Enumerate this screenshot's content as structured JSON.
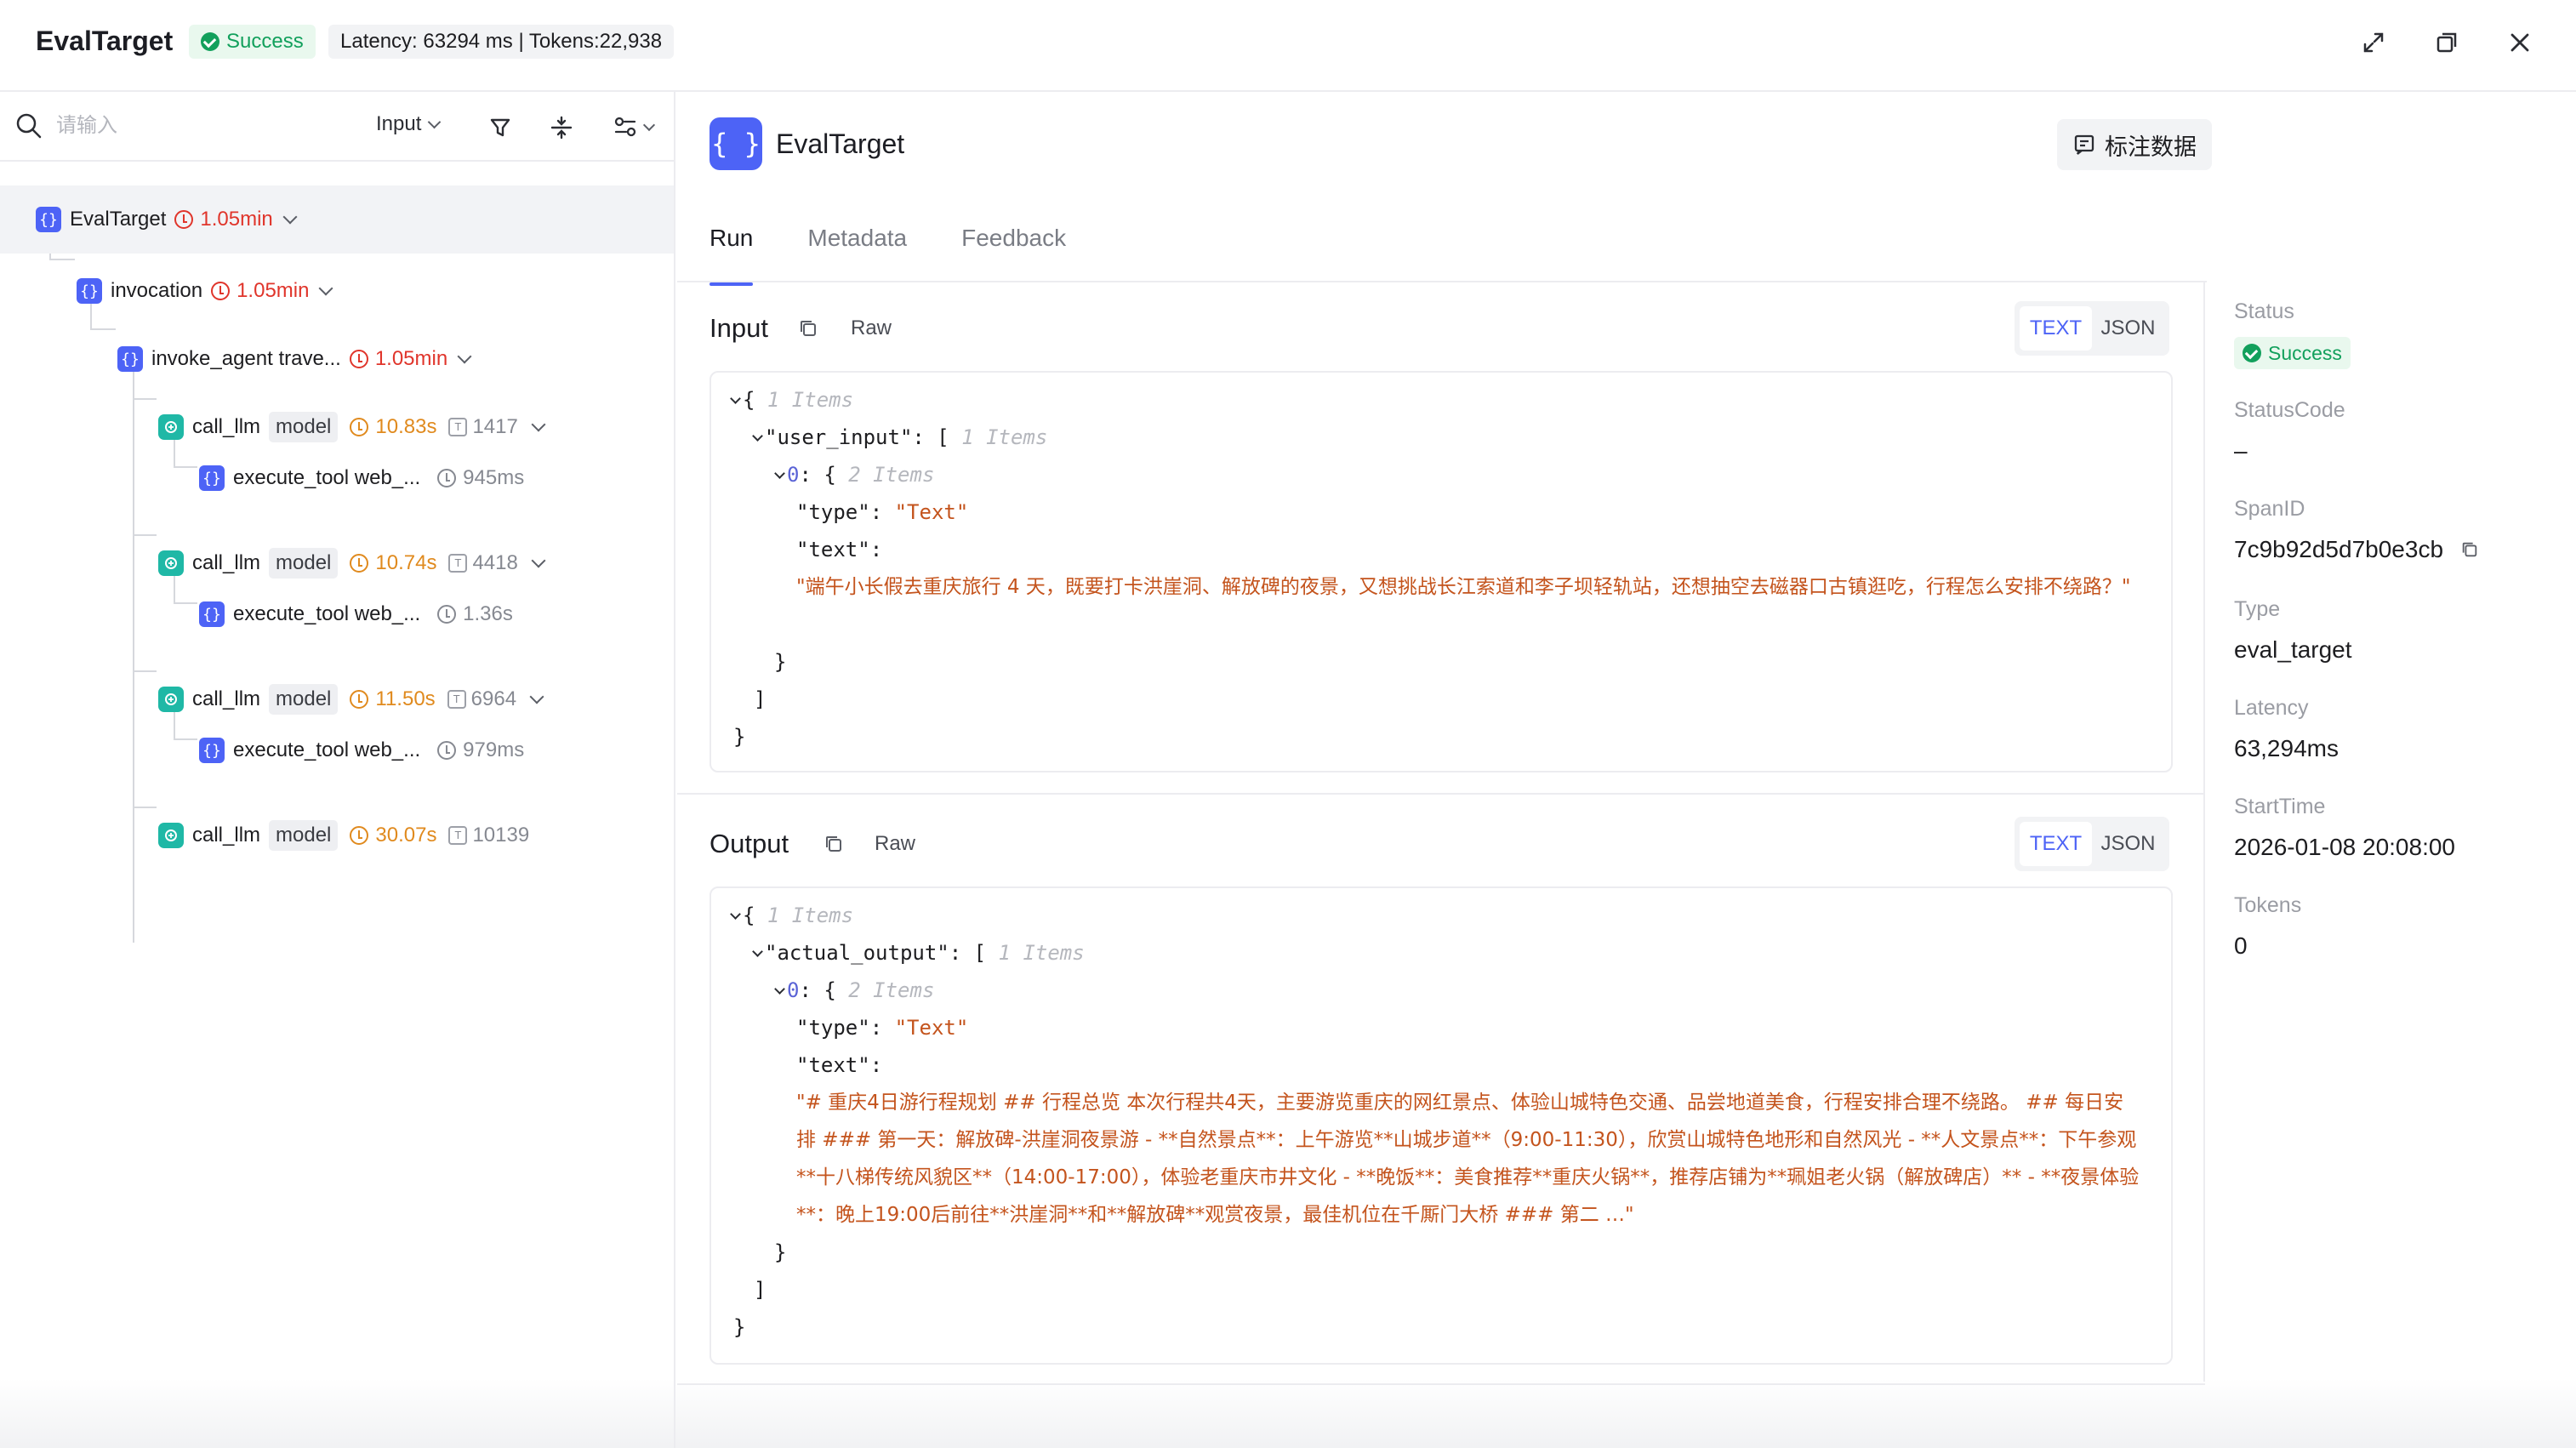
{
  "header": {
    "title": "EvalTarget",
    "status": "Success",
    "stats": "Latency: 63294 ms | Tokens:22,938"
  },
  "search": {
    "placeholder": "请输入",
    "filter_select": "Input"
  },
  "tree": {
    "nodes": [
      {
        "name": "EvalTarget",
        "duration": "1.05min"
      },
      {
        "name": "invocation",
        "duration": "1.05min"
      },
      {
        "name": "invoke_agent trave...",
        "duration": "1.05min"
      },
      {
        "name": "call_llm",
        "tag": "model",
        "duration": "10.83s",
        "tokens": "1417"
      },
      {
        "name": "execute_tool web_...",
        "duration": "945ms"
      },
      {
        "name": "call_llm",
        "tag": "model",
        "duration": "10.74s",
        "tokens": "4418"
      },
      {
        "name": "execute_tool web_...",
        "duration": "1.36s"
      },
      {
        "name": "call_llm",
        "tag": "model",
        "duration": "11.50s",
        "tokens": "6964"
      },
      {
        "name": "execute_tool web_...",
        "duration": "979ms"
      },
      {
        "name": "call_llm",
        "tag": "model",
        "duration": "30.07s",
        "tokens": "10139"
      }
    ]
  },
  "main": {
    "title": "EvalTarget",
    "annotate_label": "标注数据",
    "brace_glyph": "{ }",
    "tabs": [
      "Run",
      "Metadata",
      "Feedback"
    ]
  },
  "input": {
    "title": "Input",
    "raw": "Raw",
    "toggle": [
      "TEXT",
      "JSON"
    ],
    "items_1": "1 Items",
    "key": "\"user_input\"",
    "items_1b": "1 Items",
    "idx": "0",
    "items_2": "2 Items",
    "type_key": "\"type\"",
    "type_val": "\"Text\"",
    "text_key": "\"text\"",
    "text_val": "\"端午小长假去重庆旅行 4 天，既要打卡洪崖洞、解放碑的夜景，又想挑战长江索道和李子坝轻轨站，还想抽空去磁器口古镇逛吃，行程怎么安排不绕路？\""
  },
  "output": {
    "title": "Output",
    "raw": "Raw",
    "toggle": [
      "TEXT",
      "JSON"
    ],
    "items_1": "1 Items",
    "key": "\"actual_output\"",
    "items_1b": "1 Items",
    "idx": "0",
    "items_2": "2 Items",
    "type_key": "\"type\"",
    "type_val": "\"Text\"",
    "text_key": "\"text\"",
    "text_val": "\"# 重庆4日游行程规划 ## 行程总览 本次行程共4天，主要游览重庆的网红景点、体验山城特色交通、品尝地道美食，行程安排合理不绕路。 ## 每日安排 ### 第一天：解放碑-洪崖洞夜景游 - **自然景点**：上午游览**山城步道**（9:00-11:30），欣赏山城特色地形和自然风光 - **人文景点**：下午参观**十八梯传统风貌区**（14:00-17:00），体验老重庆市井文化 - **晚饭**：美食推荐**重庆火锅**，推荐店铺为**珮姐老火锅（解放碑店）** - **夜景体验**：晚上19:00后前往**洪崖洞**和**解放碑**观赏夜景，最佳机位在千厮门大桥 ### 第二 …\""
  },
  "info": {
    "status_label": "Status",
    "status_value": "Success",
    "status_code_label": "StatusCode",
    "status_code_value": "–",
    "span_id_label": "SpanID",
    "span_id_value": "7c9b92d5d7b0e3cb",
    "type_label": "Type",
    "type_value": "eval_target",
    "latency_label": "Latency",
    "latency_value": "63,294ms",
    "start_label": "StartTime",
    "start_value": "2026-01-08 20:08:00",
    "tokens_label": "Tokens",
    "tokens_value": "0"
  },
  "colors": {
    "accent": "#4d63f6",
    "success": "#12a05c",
    "duration_red": "#e0352b",
    "duration_orange": "#e08a1e",
    "json_string": "#c4541d",
    "llm_icon": "#1fb8a6"
  }
}
